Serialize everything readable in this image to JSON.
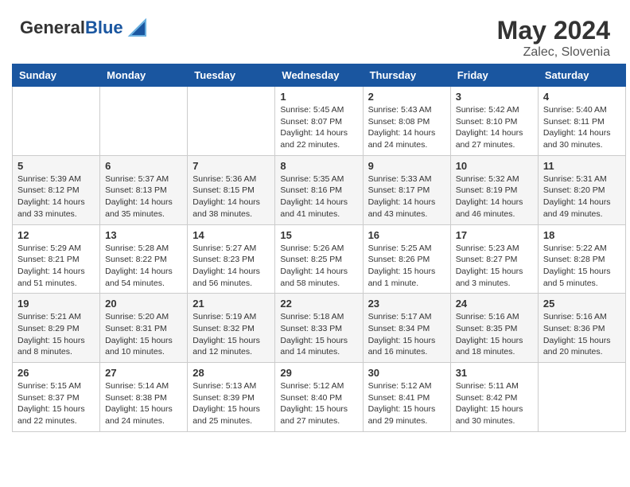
{
  "header": {
    "logo_general": "General",
    "logo_blue": "Blue",
    "month_year": "May 2024",
    "location": "Zalec, Slovenia"
  },
  "weekdays": [
    "Sunday",
    "Monday",
    "Tuesday",
    "Wednesday",
    "Thursday",
    "Friday",
    "Saturday"
  ],
  "weeks": [
    [
      {
        "day": "",
        "info": ""
      },
      {
        "day": "",
        "info": ""
      },
      {
        "day": "",
        "info": ""
      },
      {
        "day": "1",
        "info": "Sunrise: 5:45 AM\nSunset: 8:07 PM\nDaylight: 14 hours\nand 22 minutes."
      },
      {
        "day": "2",
        "info": "Sunrise: 5:43 AM\nSunset: 8:08 PM\nDaylight: 14 hours\nand 24 minutes."
      },
      {
        "day": "3",
        "info": "Sunrise: 5:42 AM\nSunset: 8:10 PM\nDaylight: 14 hours\nand 27 minutes."
      },
      {
        "day": "4",
        "info": "Sunrise: 5:40 AM\nSunset: 8:11 PM\nDaylight: 14 hours\nand 30 minutes."
      }
    ],
    [
      {
        "day": "5",
        "info": "Sunrise: 5:39 AM\nSunset: 8:12 PM\nDaylight: 14 hours\nand 33 minutes."
      },
      {
        "day": "6",
        "info": "Sunrise: 5:37 AM\nSunset: 8:13 PM\nDaylight: 14 hours\nand 35 minutes."
      },
      {
        "day": "7",
        "info": "Sunrise: 5:36 AM\nSunset: 8:15 PM\nDaylight: 14 hours\nand 38 minutes."
      },
      {
        "day": "8",
        "info": "Sunrise: 5:35 AM\nSunset: 8:16 PM\nDaylight: 14 hours\nand 41 minutes."
      },
      {
        "day": "9",
        "info": "Sunrise: 5:33 AM\nSunset: 8:17 PM\nDaylight: 14 hours\nand 43 minutes."
      },
      {
        "day": "10",
        "info": "Sunrise: 5:32 AM\nSunset: 8:19 PM\nDaylight: 14 hours\nand 46 minutes."
      },
      {
        "day": "11",
        "info": "Sunrise: 5:31 AM\nSunset: 8:20 PM\nDaylight: 14 hours\nand 49 minutes."
      }
    ],
    [
      {
        "day": "12",
        "info": "Sunrise: 5:29 AM\nSunset: 8:21 PM\nDaylight: 14 hours\nand 51 minutes."
      },
      {
        "day": "13",
        "info": "Sunrise: 5:28 AM\nSunset: 8:22 PM\nDaylight: 14 hours\nand 54 minutes."
      },
      {
        "day": "14",
        "info": "Sunrise: 5:27 AM\nSunset: 8:23 PM\nDaylight: 14 hours\nand 56 minutes."
      },
      {
        "day": "15",
        "info": "Sunrise: 5:26 AM\nSunset: 8:25 PM\nDaylight: 14 hours\nand 58 minutes."
      },
      {
        "day": "16",
        "info": "Sunrise: 5:25 AM\nSunset: 8:26 PM\nDaylight: 15 hours\nand 1 minute."
      },
      {
        "day": "17",
        "info": "Sunrise: 5:23 AM\nSunset: 8:27 PM\nDaylight: 15 hours\nand 3 minutes."
      },
      {
        "day": "18",
        "info": "Sunrise: 5:22 AM\nSunset: 8:28 PM\nDaylight: 15 hours\nand 5 minutes."
      }
    ],
    [
      {
        "day": "19",
        "info": "Sunrise: 5:21 AM\nSunset: 8:29 PM\nDaylight: 15 hours\nand 8 minutes."
      },
      {
        "day": "20",
        "info": "Sunrise: 5:20 AM\nSunset: 8:31 PM\nDaylight: 15 hours\nand 10 minutes."
      },
      {
        "day": "21",
        "info": "Sunrise: 5:19 AM\nSunset: 8:32 PM\nDaylight: 15 hours\nand 12 minutes."
      },
      {
        "day": "22",
        "info": "Sunrise: 5:18 AM\nSunset: 8:33 PM\nDaylight: 15 hours\nand 14 minutes."
      },
      {
        "day": "23",
        "info": "Sunrise: 5:17 AM\nSunset: 8:34 PM\nDaylight: 15 hours\nand 16 minutes."
      },
      {
        "day": "24",
        "info": "Sunrise: 5:16 AM\nSunset: 8:35 PM\nDaylight: 15 hours\nand 18 minutes."
      },
      {
        "day": "25",
        "info": "Sunrise: 5:16 AM\nSunset: 8:36 PM\nDaylight: 15 hours\nand 20 minutes."
      }
    ],
    [
      {
        "day": "26",
        "info": "Sunrise: 5:15 AM\nSunset: 8:37 PM\nDaylight: 15 hours\nand 22 minutes."
      },
      {
        "day": "27",
        "info": "Sunrise: 5:14 AM\nSunset: 8:38 PM\nDaylight: 15 hours\nand 24 minutes."
      },
      {
        "day": "28",
        "info": "Sunrise: 5:13 AM\nSunset: 8:39 PM\nDaylight: 15 hours\nand 25 minutes."
      },
      {
        "day": "29",
        "info": "Sunrise: 5:12 AM\nSunset: 8:40 PM\nDaylight: 15 hours\nand 27 minutes."
      },
      {
        "day": "30",
        "info": "Sunrise: 5:12 AM\nSunset: 8:41 PM\nDaylight: 15 hours\nand 29 minutes."
      },
      {
        "day": "31",
        "info": "Sunrise: 5:11 AM\nSunset: 8:42 PM\nDaylight: 15 hours\nand 30 minutes."
      },
      {
        "day": "",
        "info": ""
      }
    ]
  ]
}
